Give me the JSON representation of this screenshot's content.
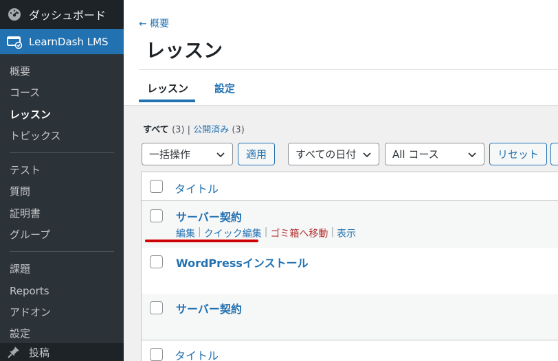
{
  "sidebar": {
    "dashboard_label": "ダッシュボード",
    "active_label": "LearnDash LMS",
    "items_group1": [
      {
        "label": "概要",
        "current": false
      },
      {
        "label": "コース",
        "current": false
      },
      {
        "label": "レッスン",
        "current": true
      },
      {
        "label": "トピックス",
        "current": false
      }
    ],
    "items_group2": [
      {
        "label": "テスト"
      },
      {
        "label": "質問"
      },
      {
        "label": "証明書"
      },
      {
        "label": "グループ"
      }
    ],
    "items_group3": [
      {
        "label": "課題"
      },
      {
        "label": "Reports"
      },
      {
        "label": "アドオン"
      },
      {
        "label": "設定"
      }
    ],
    "bottom_label": "投稿"
  },
  "header": {
    "back_link": "← 概要",
    "title": "レッスン",
    "tabs": [
      {
        "label": "レッスン",
        "active": true
      },
      {
        "label": "設定",
        "active": false
      }
    ]
  },
  "views": {
    "all_label": "すべて",
    "all_count": "(3)",
    "separator": "|",
    "published_label": "公開済み",
    "published_count": "(3)"
  },
  "filters": {
    "bulk_action": "一括操作",
    "apply_button": "適用",
    "date_filter": "すべての日付",
    "course_filter": "All コース",
    "reset_button": "リセット"
  },
  "table": {
    "column_title": "タイトル",
    "rows": [
      {
        "title": "サーバー契約",
        "show_actions": true
      },
      {
        "title": "WordPressインストール",
        "show_actions": false
      },
      {
        "title": "サーバー契約",
        "show_actions": false
      }
    ],
    "row_actions": {
      "edit": "編集",
      "quick_edit": "クイック編集",
      "trash": "ゴミ箱へ移動",
      "view": "表示",
      "pipe": "|"
    }
  },
  "colors": {
    "sidebar_bg": "#1d2327",
    "accent": "#2271b1",
    "trash": "#b32d2e",
    "highlight_underline": "#d00000"
  }
}
